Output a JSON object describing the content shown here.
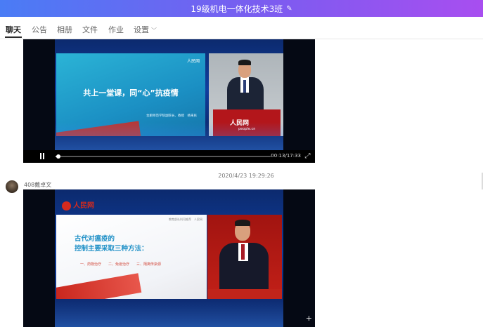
{
  "header": {
    "title": "19级机电一体化技术3班",
    "edit_icon": "pencil-icon"
  },
  "tabs": [
    {
      "label": "聊天",
      "active": true
    },
    {
      "label": "公告"
    },
    {
      "label": "相册"
    },
    {
      "label": "文件"
    },
    {
      "label": "作业"
    },
    {
      "label": "设置"
    }
  ],
  "messages": [
    {
      "type": "video",
      "slide_title": "共上一堂课，同“心”抗疫情",
      "slide_subtitle": "合肥师范学院副院长、教授　杨来民",
      "slide_logo": "人民网",
      "podium_logo": "人民网",
      "podium_url": "people.cn",
      "current_time": "00:13",
      "duration": "17:33",
      "time_display": "00:13/17:33",
      "progress": 0.0125
    },
    {
      "type": "video",
      "timestamp": "2020/4/23 19:29:26",
      "sender": "408戴卓文",
      "slide_title": "古代对瘟疫的\n控制主要采取三种方法：",
      "slide_items": "一、药物治疗　　二、免疫治疗　　三、隔离传染源",
      "slide_header": "教育部社科司推荐　人民网",
      "logo": "人民网"
    }
  ],
  "colors": {
    "header_start": "#4a7cf5",
    "header_end": "#a84ef0",
    "brand_red": "#d42a1e",
    "slide_blue": "#1d8fc6"
  }
}
